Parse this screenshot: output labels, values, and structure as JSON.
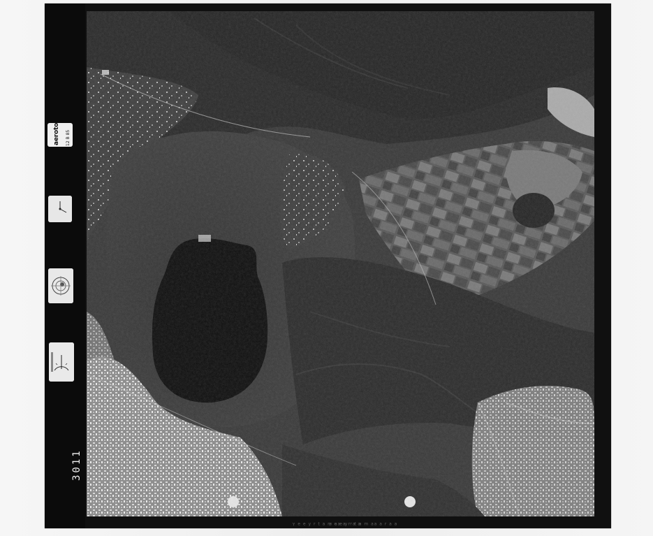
{
  "frame": {
    "label_brand": "aerotop",
    "label_sub": "12 B 85",
    "frame_number": "3011",
    "edge_code_left": "ɐ ɐ ɹ ɐ    ɐɐ ɯ ɐ ʇ ɹ   ʎ  ǝ ǝ ⅄",
    "edge_code_right": "ɐ ɐ ɹ ɐ    ɐɐ ɯ ɐ ʇ ɹ   ʎ  ǝ ǝ ⅄"
  },
  "colors": {
    "frame": "#101010",
    "paper": "#f4f4f4",
    "lake": "#080808",
    "forest": "#2b2b2b",
    "urban": "#cfcfcf"
  }
}
